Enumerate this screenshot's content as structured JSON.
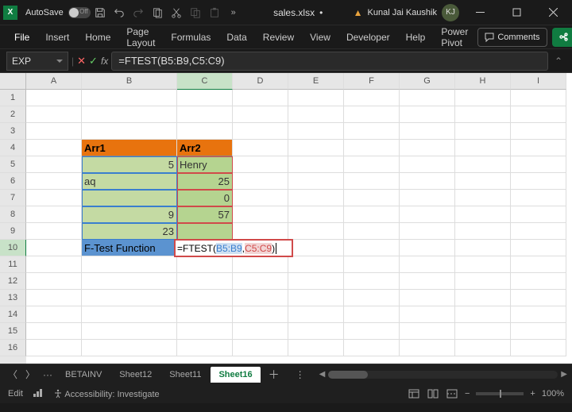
{
  "titlebar": {
    "autosave_label": "AutoSave",
    "autosave_state": "Off",
    "filename": "sales.xlsx",
    "separator": "•",
    "username": "Kunal Jai Kaushik",
    "avatar": "KJ",
    "ellipsis": "…"
  },
  "ribbon": {
    "tabs": [
      "File",
      "Insert",
      "Home",
      "Page Layout",
      "Formulas",
      "Data",
      "Review",
      "View",
      "Developer",
      "Help",
      "Power Pivot"
    ],
    "comments": "Comments"
  },
  "formula": {
    "namebox": "EXP",
    "fx": "fx",
    "content": "=FTEST(B5:B9,C5:C9)"
  },
  "cols": [
    "A",
    "B",
    "C",
    "D",
    "E",
    "F",
    "G",
    "H",
    "I"
  ],
  "rows": [
    "1",
    "2",
    "3",
    "4",
    "5",
    "6",
    "7",
    "8",
    "9",
    "10",
    "11",
    "12",
    "13",
    "14",
    "15",
    "16"
  ],
  "cells": {
    "b4": "Arr1",
    "c4": "Arr2",
    "b5": "5",
    "c5": "Henry",
    "b6": "aq",
    "c6": "25",
    "b7": "",
    "c7": "0",
    "b8": "9",
    "c8": "57",
    "b9": "23",
    "b10": "F-Test Function"
  },
  "edit": {
    "eq": "=",
    "fn": "FTEST(",
    "ref1": "B5:B9",
    "comma": ",",
    "ref2": "C5:C9",
    "paren": ")"
  },
  "sheets": {
    "ellipsis": "···",
    "tabs": [
      "BETAINV",
      "Sheet12",
      "Sheet11",
      "Sheet16"
    ],
    "active": 3,
    "more": "⋮"
  },
  "status": {
    "mode": "Edit",
    "accessibility": "Accessibility: Investigate",
    "zoom": "100%",
    "minus": "−",
    "plus": "+"
  }
}
